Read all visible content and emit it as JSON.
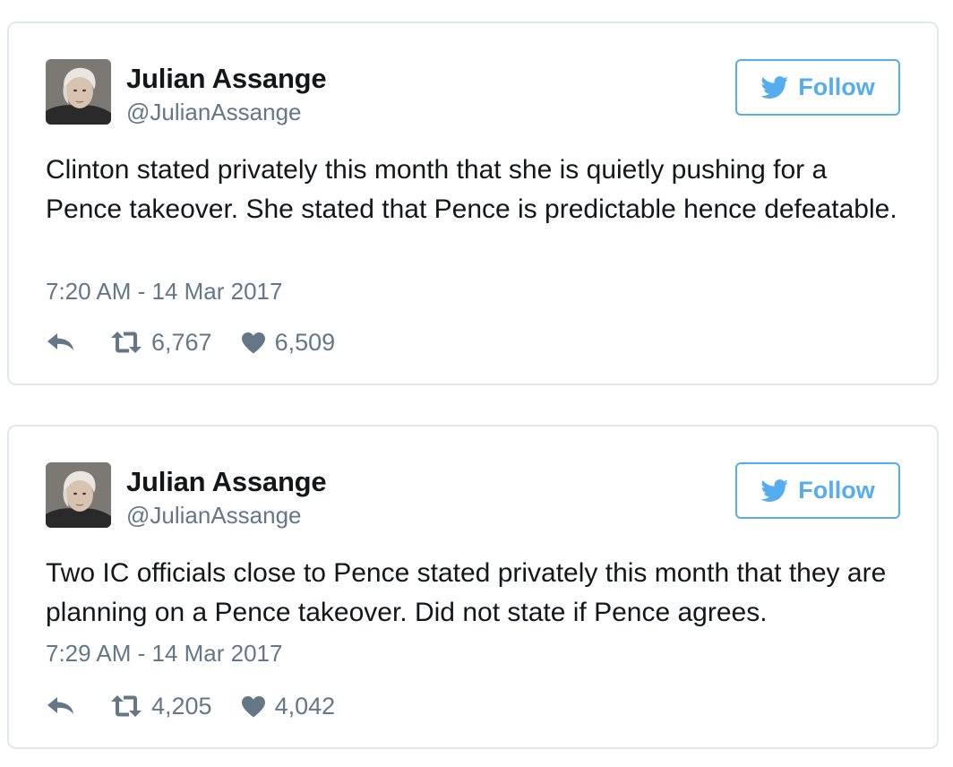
{
  "tweets": [
    {
      "name": "Julian Assange",
      "handle": "@JulianAssange",
      "follow_label": "Follow",
      "text": "Clinton stated privately this month that she is quietly pushing for a Pence takeover. She stated that Pence is predictable hence defeatable.",
      "timestamp": "7:20 AM - 14 Mar 2017",
      "retweets": "6,767",
      "likes": "6,509"
    },
    {
      "name": "Julian Assange",
      "handle": "@JulianAssange",
      "follow_label": "Follow",
      "text": "Two IC officials close to Pence stated privately this month that they are planning on a Pence takeover. Did not state if Pence agrees.",
      "timestamp": "7:29 AM - 14 Mar 2017",
      "retweets": "4,205",
      "likes": "4,042"
    }
  ],
  "icons": {
    "follow": "twitter-bird-icon",
    "reply": "reply-icon",
    "retweet": "retweet-icon",
    "like": "heart-icon"
  },
  "colors": {
    "accent": "#55acee",
    "secondary_text": "#657786",
    "border": "#e1e8ed"
  }
}
